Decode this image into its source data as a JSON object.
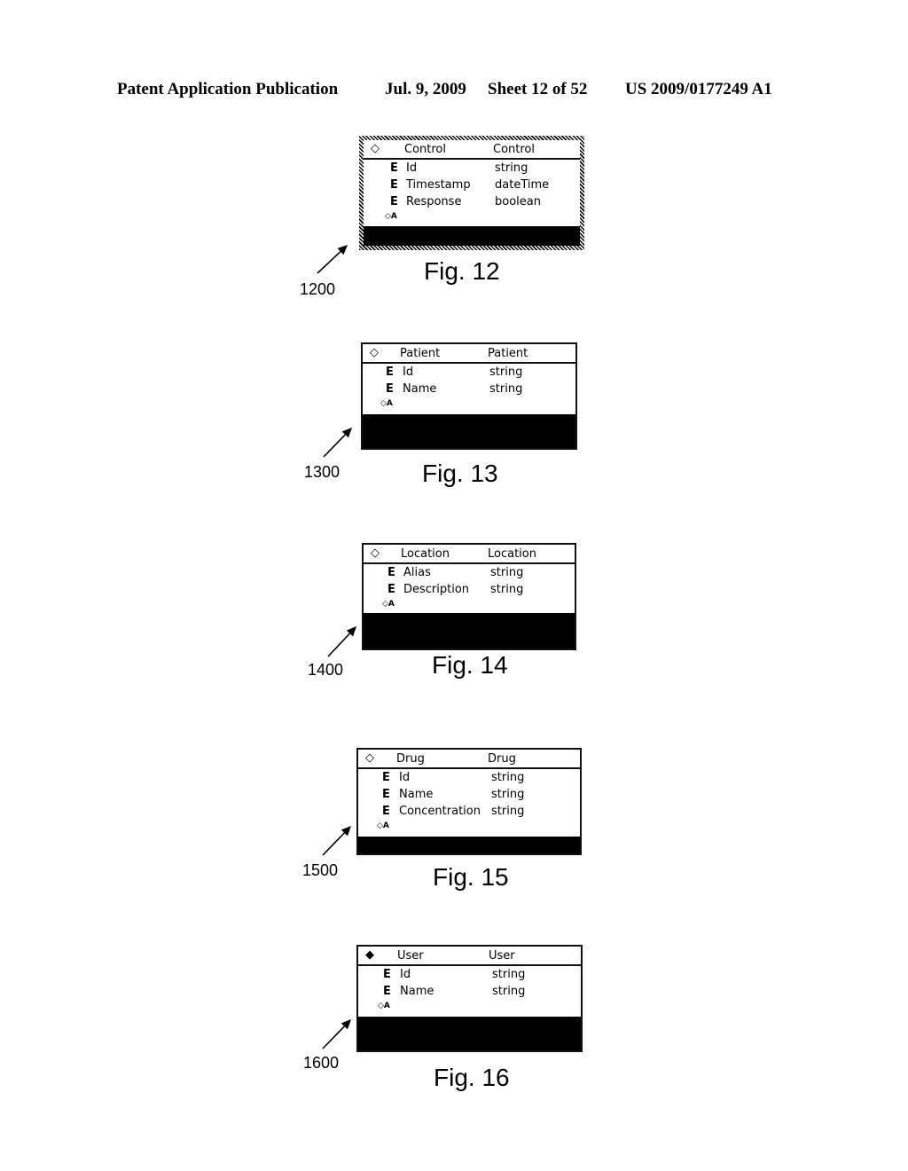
{
  "header": {
    "publication": "Patent Application Publication",
    "date": "Jul. 9, 2009",
    "sheet": "Sheet 12 of 52",
    "number": "US 2009/0177249 A1"
  },
  "icons": {
    "complex_type_open": "◇",
    "complex_type_filled": "◆",
    "element": "E",
    "attribute_group": "◇A"
  },
  "figures": [
    {
      "figure_label": "Fig. 12",
      "reference": "1200",
      "entity": "Control",
      "entity_type": "Control",
      "diamond": "◇",
      "hatched_border": true,
      "fields": [
        {
          "marker": "E",
          "name": "Id",
          "type": "string"
        },
        {
          "marker": "E",
          "name": "Timestamp",
          "type": "dateTime"
        },
        {
          "marker": "E",
          "name": "Response",
          "type": "boolean"
        }
      ],
      "attribute_marker": "◇A"
    },
    {
      "figure_label": "Fig. 13",
      "reference": "1300",
      "entity": "Patient",
      "entity_type": "Patient",
      "diamond": "◇",
      "hatched_border": false,
      "fields": [
        {
          "marker": "E",
          "name": "Id",
          "type": "string"
        },
        {
          "marker": "E",
          "name": "Name",
          "type": "string"
        }
      ],
      "attribute_marker": "◇A"
    },
    {
      "figure_label": "Fig. 14",
      "reference": "1400",
      "entity": "Location",
      "entity_type": "Location",
      "diamond": "◇",
      "hatched_border": false,
      "fields": [
        {
          "marker": "E",
          "name": "Alias",
          "type": "string"
        },
        {
          "marker": "E",
          "name": "Description",
          "type": "string"
        }
      ],
      "attribute_marker": "◇A"
    },
    {
      "figure_label": "Fig. 15",
      "reference": "1500",
      "entity": "Drug",
      "entity_type": "Drug",
      "diamond": "◇",
      "hatched_border": false,
      "fields": [
        {
          "marker": "E",
          "name": "Id",
          "type": "string"
        },
        {
          "marker": "E",
          "name": "Name",
          "type": "string"
        },
        {
          "marker": "E",
          "name": "Concentration",
          "type": "string"
        }
      ],
      "attribute_marker": "◇A"
    },
    {
      "figure_label": "Fig. 16",
      "reference": "1600",
      "entity": "User",
      "entity_type": "User",
      "diamond": "◆",
      "hatched_border": false,
      "fields": [
        {
          "marker": "E",
          "name": "Id",
          "type": "string"
        },
        {
          "marker": "E",
          "name": "Name",
          "type": "string"
        }
      ],
      "attribute_marker": "◇A"
    }
  ]
}
